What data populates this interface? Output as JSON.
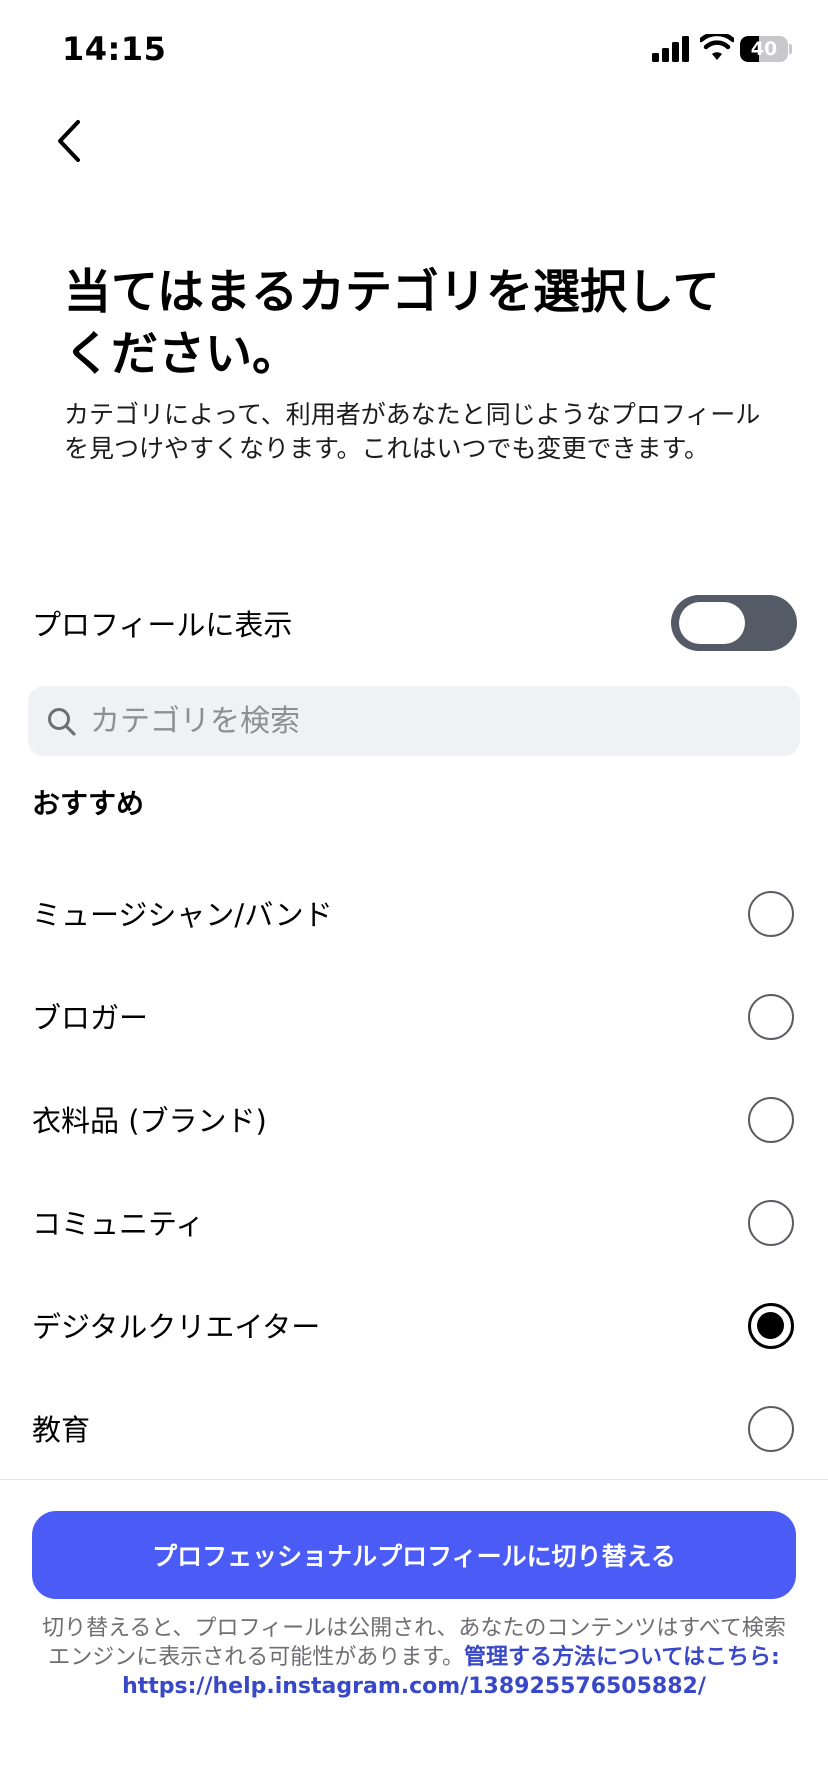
{
  "status_bar": {
    "time": "14:15",
    "battery_percent": 40,
    "battery_text": "40"
  },
  "header": {
    "title": "当てはまるカテゴリを選択してください。",
    "description": "カテゴリによって、利用者があなたと同じようなプロフィールを見つけやすくなります。これはいつでも変更できます。"
  },
  "profile_display": {
    "label": "プロフィールに表示",
    "enabled": false
  },
  "search": {
    "placeholder": "カテゴリを検索",
    "value": ""
  },
  "section": {
    "heading": "おすすめ"
  },
  "categories": [
    {
      "label": "ミュージシャン/バンド",
      "selected": false
    },
    {
      "label": "ブロガー",
      "selected": false
    },
    {
      "label": "衣料品 (ブランド)",
      "selected": false
    },
    {
      "label": "コミュニティ",
      "selected": false
    },
    {
      "label": "デジタルクリエイター",
      "selected": true
    },
    {
      "label": "教育",
      "selected": false
    }
  ],
  "footer": {
    "button_label": "プロフェッショナルプロフィールに切り替える",
    "note_text": "切り替えると、プロフィールは公開され、あなたのコンテンツはすべて検索エンジンに表示される可能性があります。",
    "link_text": "管理する方法についてはこちら: https://help.instagram.com/138925576505882/"
  },
  "colors": {
    "accent": "#4a5cf5",
    "link": "#3848c8",
    "toggle_off": "#545a66",
    "search_bg": "#f0f1f5"
  }
}
